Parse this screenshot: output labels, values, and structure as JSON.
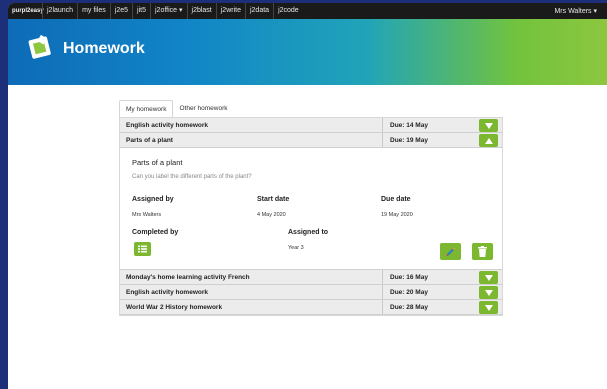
{
  "topbar": {
    "logo": "purpl2easy",
    "nav": [
      "j2launch",
      "my files",
      "j2e5",
      "jit5",
      "j2office ▾",
      "j2blast",
      "j2write",
      "j2data",
      "j2code"
    ],
    "user": "Mrs Walters ▾"
  },
  "banner": {
    "title": "Homework"
  },
  "tabs": {
    "my_homework": "My homework",
    "other_homework": "Other homework"
  },
  "rows": [
    {
      "name": "English activity homework",
      "due": "Due: 14 May"
    },
    {
      "name": "Parts of a plant",
      "due": "Due: 19 May"
    },
    {
      "name": "Monday's home learning activity French",
      "due": "Due: 16 May"
    },
    {
      "name": "English activity homework",
      "due": "Due: 20 May"
    },
    {
      "name": "World War 2 History homework",
      "due": "Due: 28 May"
    }
  ],
  "detail": {
    "title": "Parts of a plant",
    "description": "Can you label the different parts of the plant?",
    "assigned_by_label": "Assigned by",
    "assigned_by": "Mrs Walters",
    "start_date_label": "Start date",
    "start_date": "4 May 2020",
    "due_date_label": "Due date",
    "due_date": "19 May 2020",
    "completed_by_label": "Completed by",
    "assigned_to_label": "Assigned to",
    "assigned_to": "Year 3"
  },
  "colors": {
    "accent": "#7cb82f",
    "topbar": "#1a1a1a",
    "backdrop": "#1d2f78"
  },
  "icons": {
    "expand": "chevron-down-icon",
    "collapse": "chevron-up-icon",
    "list": "list-icon",
    "edit": "edit-icon",
    "delete": "trash-icon"
  }
}
